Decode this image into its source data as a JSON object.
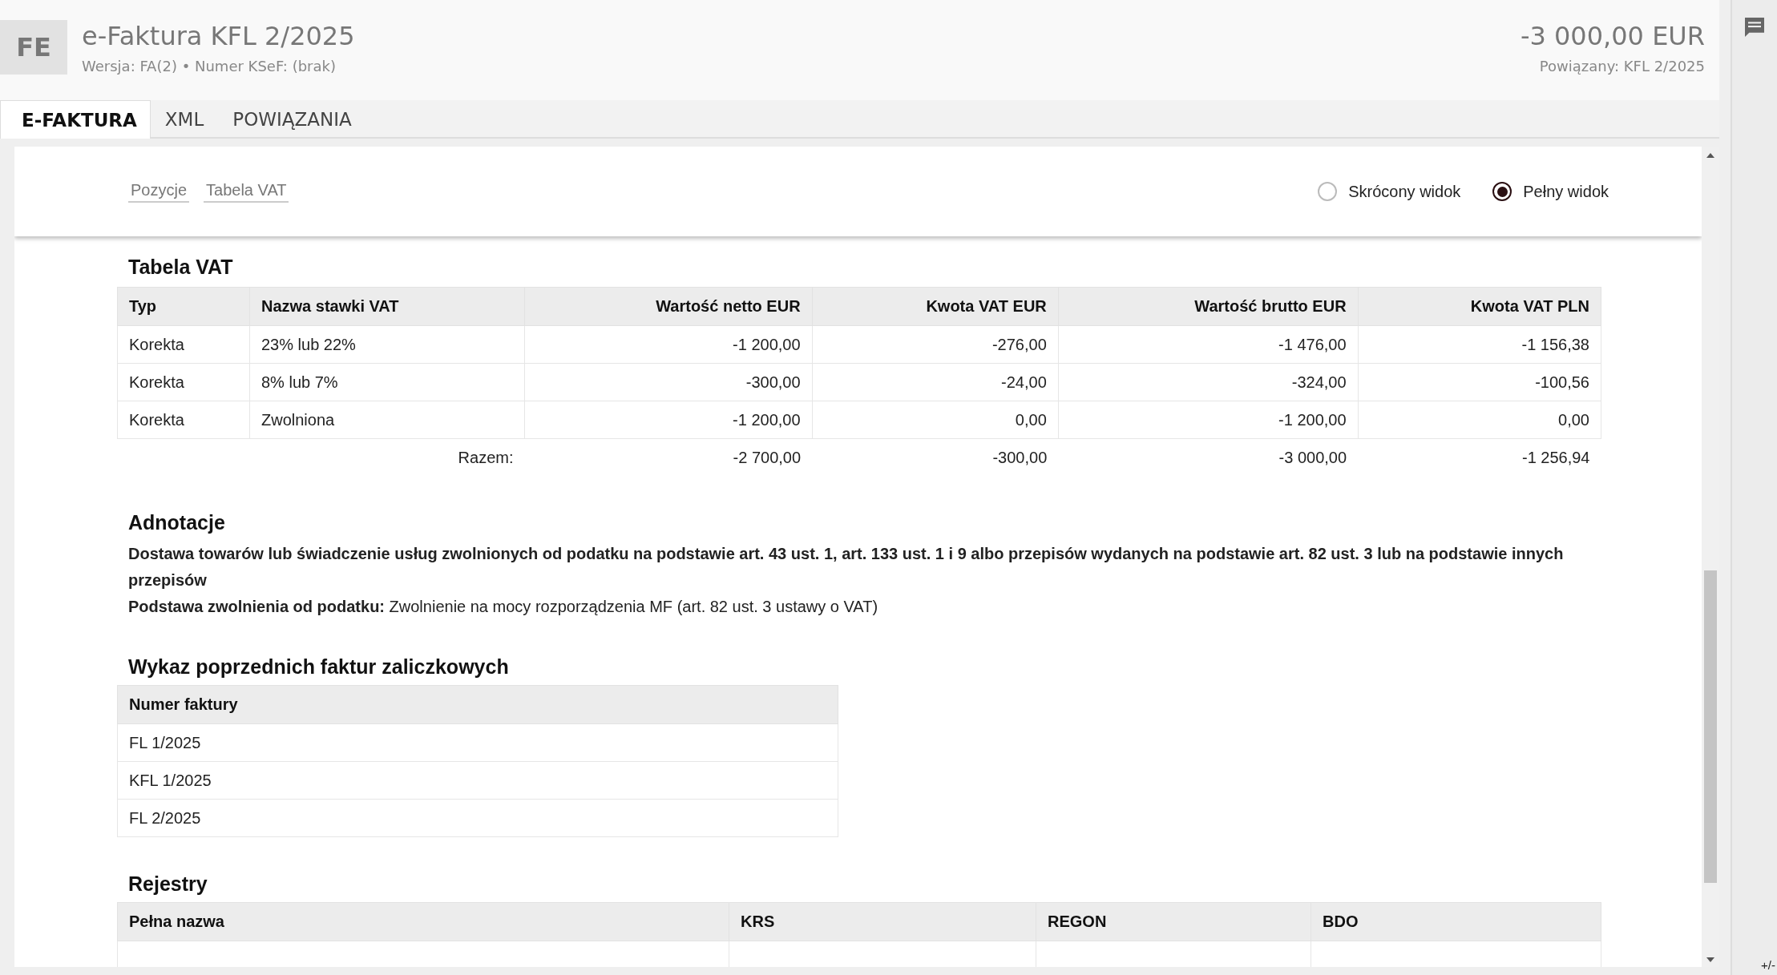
{
  "header": {
    "badge": "FE",
    "title": "e-Faktura KFL 2/2025",
    "subtitle": "Wersja: FA(2) • Numer KSeF: (brak)",
    "amount": "-3 000,00 EUR",
    "related": "Powiązany: KFL 2/2025"
  },
  "tabs": [
    {
      "label": "E-FAKTURA",
      "selected": true
    },
    {
      "label": "XML",
      "selected": false
    },
    {
      "label": "POWIĄZANIA",
      "selected": false
    }
  ],
  "toolbar": {
    "links": [
      "Pozycje",
      "Tabela VAT"
    ],
    "view_options": [
      {
        "label": "Skrócony widok",
        "selected": false
      },
      {
        "label": "Pełny widok",
        "selected": true
      }
    ]
  },
  "vat_table": {
    "title": "Tabela VAT",
    "columns": [
      "Typ",
      "Nazwa stawki VAT",
      "Wartość netto EUR",
      "Kwota VAT EUR",
      "Wartość brutto EUR",
      "Kwota VAT PLN"
    ],
    "rows": [
      [
        "Korekta",
        "23% lub 22%",
        "-1 200,00",
        "-276,00",
        "-1 476,00",
        "-1 156,38"
      ],
      [
        "Korekta",
        "8% lub 7%",
        "-300,00",
        "-24,00",
        "-324,00",
        "-100,56"
      ],
      [
        "Korekta",
        "Zwolniona",
        "-1 200,00",
        "0,00",
        "-1 200,00",
        "0,00"
      ]
    ],
    "total_label": "Razem:",
    "totals": [
      "-2 700,00",
      "-300,00",
      "-3 000,00",
      "-1 256,94"
    ]
  },
  "annotations": {
    "title": "Adnotacje",
    "lines": [
      "**Dostawa towarów lub świadczenie usług zwolnionych od podatku na podstawie art. 43 ust. 1, art. 133 ust. 1 i 9 albo przepisów wydanych na podstawie art. 82 ust. 3 lub na podstawie innych przepisów**",
      "**Podstawa zwolnienia od podatku:** Zwolnienie na mocy rozporządzenia MF (art. 82 ust. 3 ustawy o VAT)"
    ]
  },
  "advance_invoices": {
    "title": "Wykaz poprzednich faktur zaliczkowych",
    "column": "Numer faktury",
    "rows": [
      "FL 1/2025",
      "KFL 1/2025",
      "FL 2/2025"
    ]
  },
  "registers": {
    "title": "Rejestry",
    "columns": [
      "Pełna nazwa",
      "KRS",
      "REGON",
      "BDO"
    ]
  },
  "sidebar": {
    "zoom_label": "+/-"
  }
}
